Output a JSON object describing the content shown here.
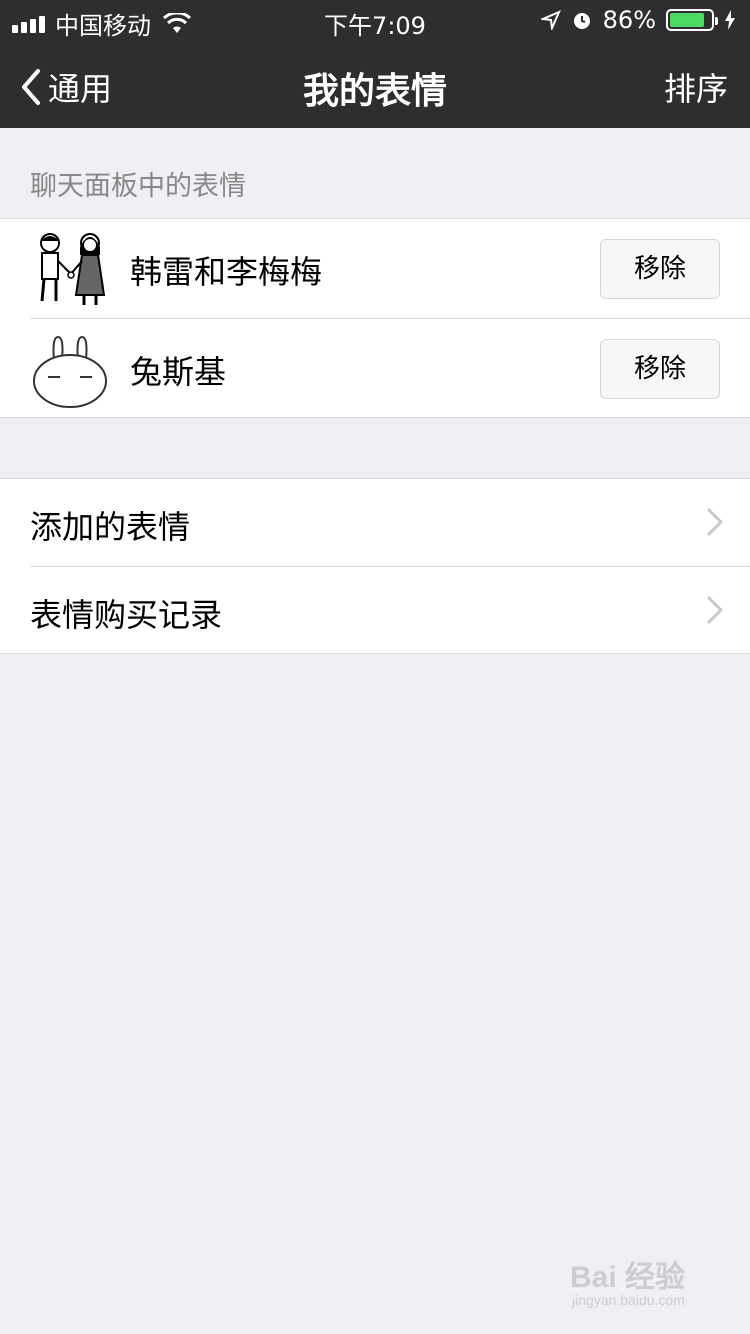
{
  "status_bar": {
    "carrier": "中国移动",
    "time": "下午7:09",
    "battery": "86%",
    "battery_level": 0.86
  },
  "nav": {
    "back_label": "通用",
    "title": "我的表情",
    "right_label": "排序"
  },
  "section_header": "聊天面板中的表情",
  "sticker_packs": [
    {
      "name": "韩雷和李梅梅",
      "button": "移除"
    },
    {
      "name": "兔斯基",
      "button": "移除"
    }
  ],
  "menu_items": [
    {
      "label": "添加的表情"
    },
    {
      "label": "表情购买记录"
    }
  ],
  "watermark": {
    "brand": "Bai 经验",
    "sub": "jingyan.baidu.com"
  },
  "colors": {
    "nav_bg": "#2e2e31",
    "page_bg": "#efeff4",
    "battery_fill": "#4cd964"
  }
}
